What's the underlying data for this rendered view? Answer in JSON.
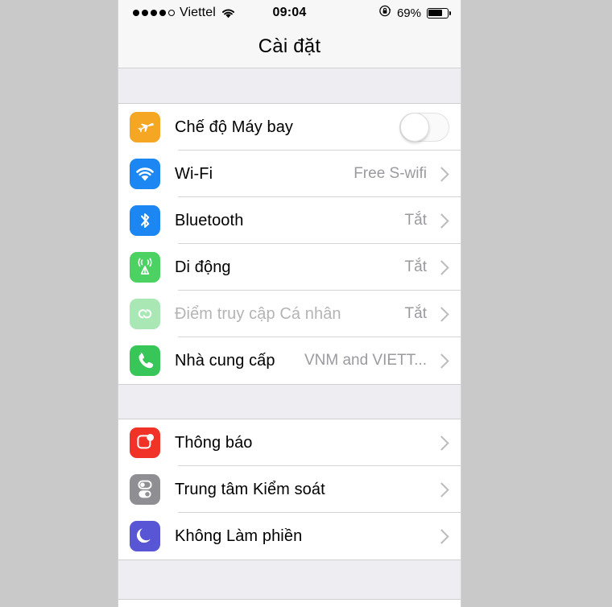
{
  "status_bar": {
    "signal_dots_filled": 4,
    "signal_dots_total": 5,
    "carrier": "Viettel",
    "wifi_icon": "wifi-icon",
    "time": "09:04",
    "rotation_lock_icon": "rotation-lock-icon",
    "battery_percent": "69%",
    "battery_level": 69
  },
  "nav": {
    "title": "Cài đặt"
  },
  "groups": [
    {
      "rows": [
        {
          "icon": "airplane-icon",
          "icon_color": "#f5a623",
          "label": "Chế độ Máy bay",
          "accessory": "toggle",
          "toggle_on": false,
          "value": "",
          "disabled": false
        },
        {
          "icon": "wifi-icon",
          "icon_color": "#1c86f2",
          "label": "Wi-Fi",
          "accessory": "chevron",
          "value": "Free S-wifi",
          "disabled": false
        },
        {
          "icon": "bluetooth-icon",
          "icon_color": "#1c86f2",
          "label": "Bluetooth",
          "accessory": "chevron",
          "value": "Tắt",
          "disabled": false
        },
        {
          "icon": "cellular-antenna-icon",
          "icon_color": "#4cd263",
          "label": "Di động",
          "accessory": "chevron",
          "value": "Tắt",
          "disabled": false
        },
        {
          "icon": "personal-hotspot-icon",
          "icon_color": "#a9e8b5",
          "label": "Điểm truy cập Cá nhân",
          "accessory": "chevron",
          "value": "Tắt",
          "disabled": true
        },
        {
          "icon": "phone-handset-icon",
          "icon_color": "#38c659",
          "label": "Nhà cung cấp",
          "accessory": "chevron",
          "value": "VNM and VIETT...",
          "disabled": false
        }
      ]
    },
    {
      "rows": [
        {
          "icon": "notifications-icon",
          "icon_color": "#f03227",
          "label": "Thông báo",
          "accessory": "chevron",
          "value": "",
          "disabled": false
        },
        {
          "icon": "control-center-icon",
          "icon_color": "#8e8e93",
          "label": "Trung tâm Kiểm soát",
          "accessory": "chevron",
          "value": "",
          "disabled": false
        },
        {
          "icon": "do-not-disturb-moon-icon",
          "icon_color": "#5956d6",
          "label": "Không Làm phiền",
          "accessory": "chevron",
          "value": "",
          "disabled": false
        }
      ]
    }
  ],
  "colors": {
    "page_background": "#c9c9c9",
    "screen_background": "#ffffff",
    "group_gap": "#eeeef2",
    "separator": "#d4d4d6",
    "value_text": "#9a9a9f",
    "disabled_text": "#b4b4b6"
  }
}
